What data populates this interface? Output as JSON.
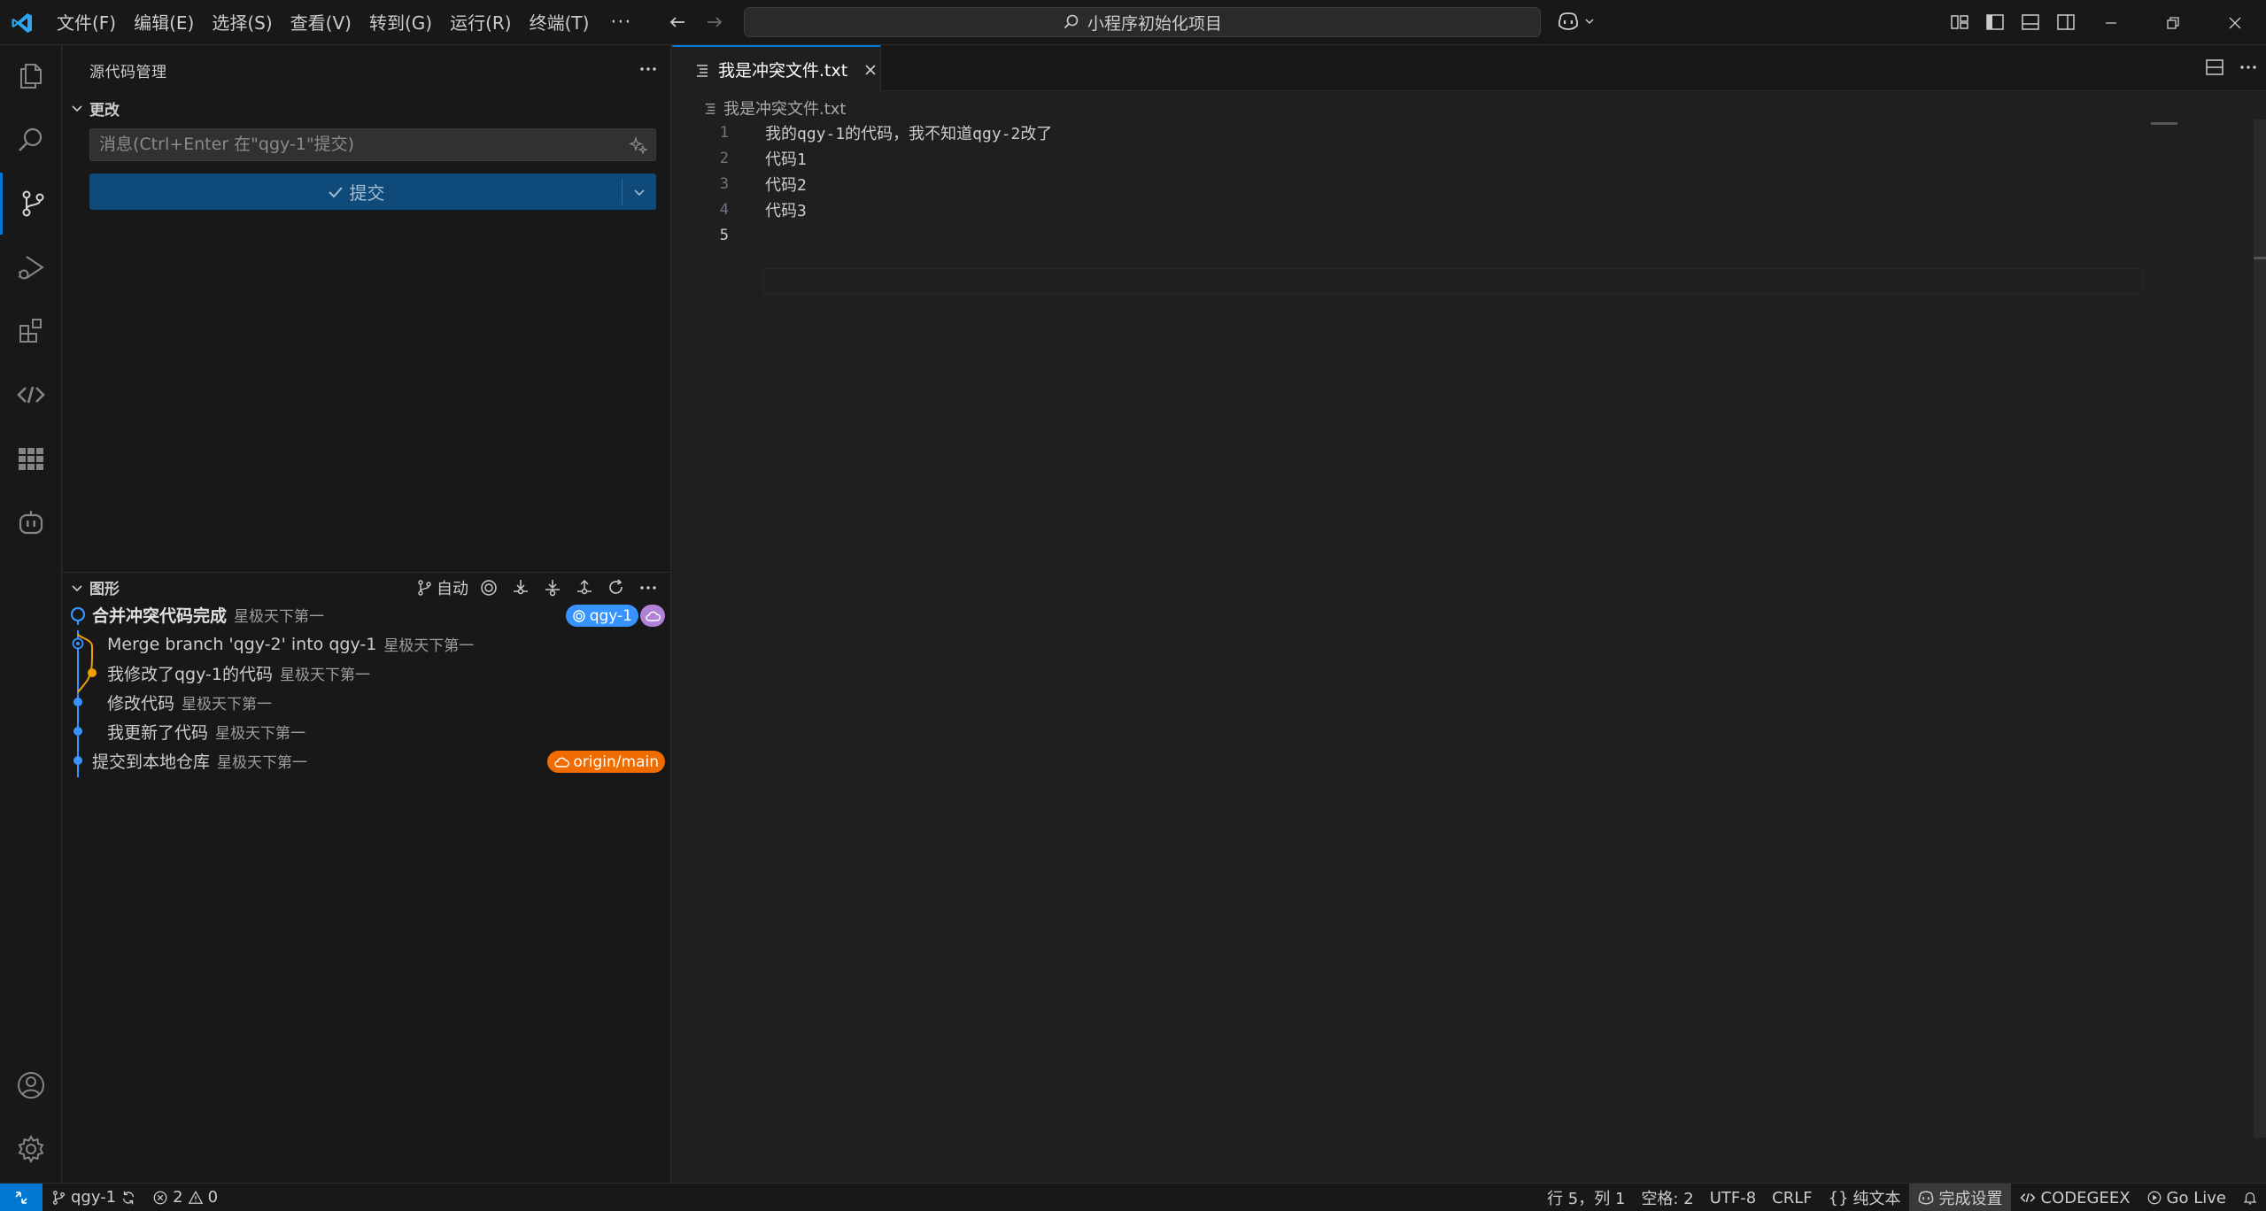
{
  "titlebar": {
    "menu": [
      "文件(F)",
      "编辑(E)",
      "选择(S)",
      "查看(V)",
      "转到(G)",
      "运行(R)",
      "终端(T)"
    ],
    "more": "···",
    "search_text": "小程序初始化项目"
  },
  "activitybar": {
    "items": [
      "explorer-icon",
      "search-icon",
      "source-control-icon",
      "run-debug-icon",
      "extensions-icon",
      "codegeex-icon",
      "apps-grid-icon",
      "robot-icon"
    ],
    "bottom": [
      "account-icon",
      "settings-gear-icon"
    ],
    "active": "source-control-icon"
  },
  "sidebar": {
    "title": "源代码管理",
    "changes": {
      "header": "更改",
      "placeholder": "消息(Ctrl+Enter 在\"qgy-1\"提交)",
      "commit_label": "提交"
    },
    "graph": {
      "header": "图形",
      "auto_label": "自动",
      "rows": [
        {
          "message": "合并冲突代码完成",
          "author": "星极天下第一",
          "bold": true,
          "badge": "qgy-1"
        },
        {
          "message": "Merge branch 'qgy-2' into qgy-1",
          "author": "星极天下第一",
          "bold": false
        },
        {
          "message": "我修改了qgy-1的代码",
          "author": "星极天下第一",
          "bold": false
        },
        {
          "message": "修改代码",
          "author": "星极天下第一",
          "bold": false
        },
        {
          "message": "我更新了代码",
          "author": "星极天下第一",
          "bold": false
        },
        {
          "message": "提交到本地仓库",
          "author": "星极天下第一",
          "bold": false,
          "badge": "origin/main"
        }
      ]
    }
  },
  "editor": {
    "tab_name": "我是冲突文件.txt",
    "breadcrumb": "我是冲突文件.txt",
    "lines": [
      {
        "num": "1",
        "text": "我的qgy-1的代码，我不知道qgy-2改了"
      },
      {
        "num": "2",
        "text": "代码1"
      },
      {
        "num": "3",
        "text": "代码2"
      },
      {
        "num": "4",
        "text": "代码3"
      },
      {
        "num": "5",
        "text": ""
      }
    ]
  },
  "statusbar": {
    "branch": "qgy-1",
    "errors": "2",
    "warnings": "0",
    "position": "行 5，列 1",
    "spaces": "空格: 2",
    "encoding": "UTF-8",
    "eol": "CRLF",
    "language": "纯文本",
    "copilot": "完成设置",
    "codegeex": "CODEGEEX",
    "golive": "Go Live"
  },
  "colors": {
    "accent": "#0078d4",
    "graph_blue": "#3794ff",
    "graph_orange": "#f0a000",
    "badge_orange": "#f06c00",
    "badge_purple": "#b180d7"
  }
}
